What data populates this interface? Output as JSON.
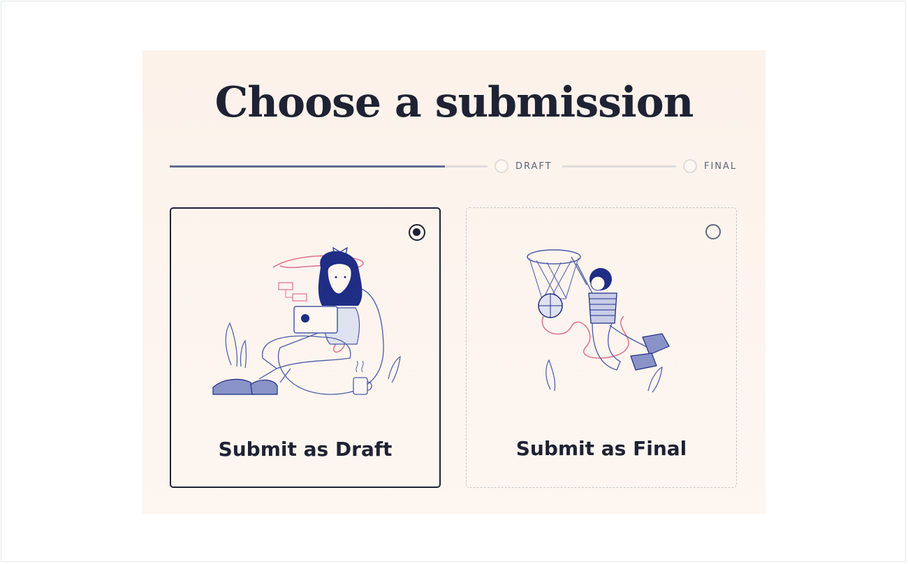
{
  "page": {
    "title": "Choose a submission"
  },
  "stepper": {
    "progress": 0.5,
    "steps": [
      {
        "label": "DRAFT",
        "completed": false
      },
      {
        "label": "FINAL",
        "completed": false
      }
    ]
  },
  "options": [
    {
      "label": "Submit as Draft",
      "selected": true,
      "illustration": "woman-with-laptop-illustration"
    },
    {
      "label": "Submit as Final",
      "selected": false,
      "illustration": "basketball-player-illustration"
    }
  ],
  "colors": {
    "background": "#fdf6f1",
    "ink": "#1e2233",
    "accent_line": "#5f6e92",
    "illustration_blue": "#3c4aa0",
    "illustration_pink": "#e0708c"
  }
}
